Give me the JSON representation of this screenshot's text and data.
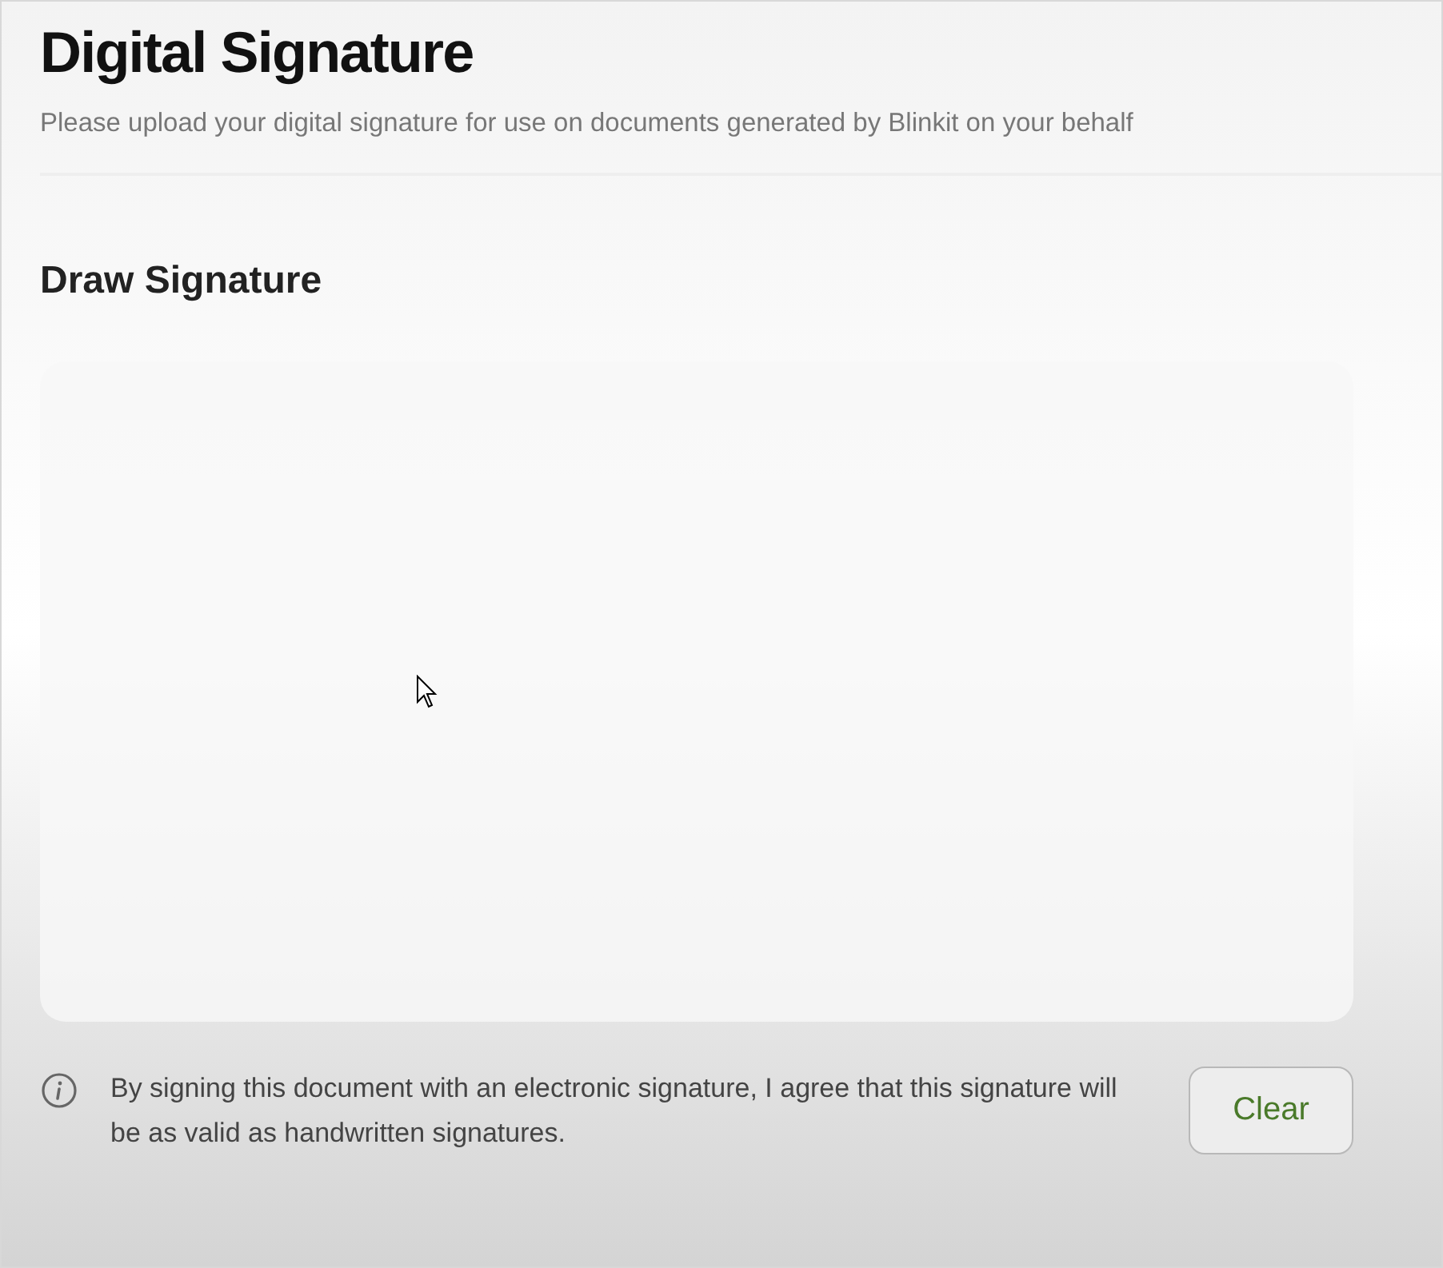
{
  "header": {
    "title": "Digital Signature",
    "subtitle": "Please upload your digital signature for use on documents generated by Blinkit on your behalf"
  },
  "section": {
    "title": "Draw Signature"
  },
  "consent": {
    "text": "By signing this document with an electronic signature, I agree that this signature will be as valid as handwritten signatures."
  },
  "buttons": [
    {
      "label": "Clear"
    }
  ]
}
